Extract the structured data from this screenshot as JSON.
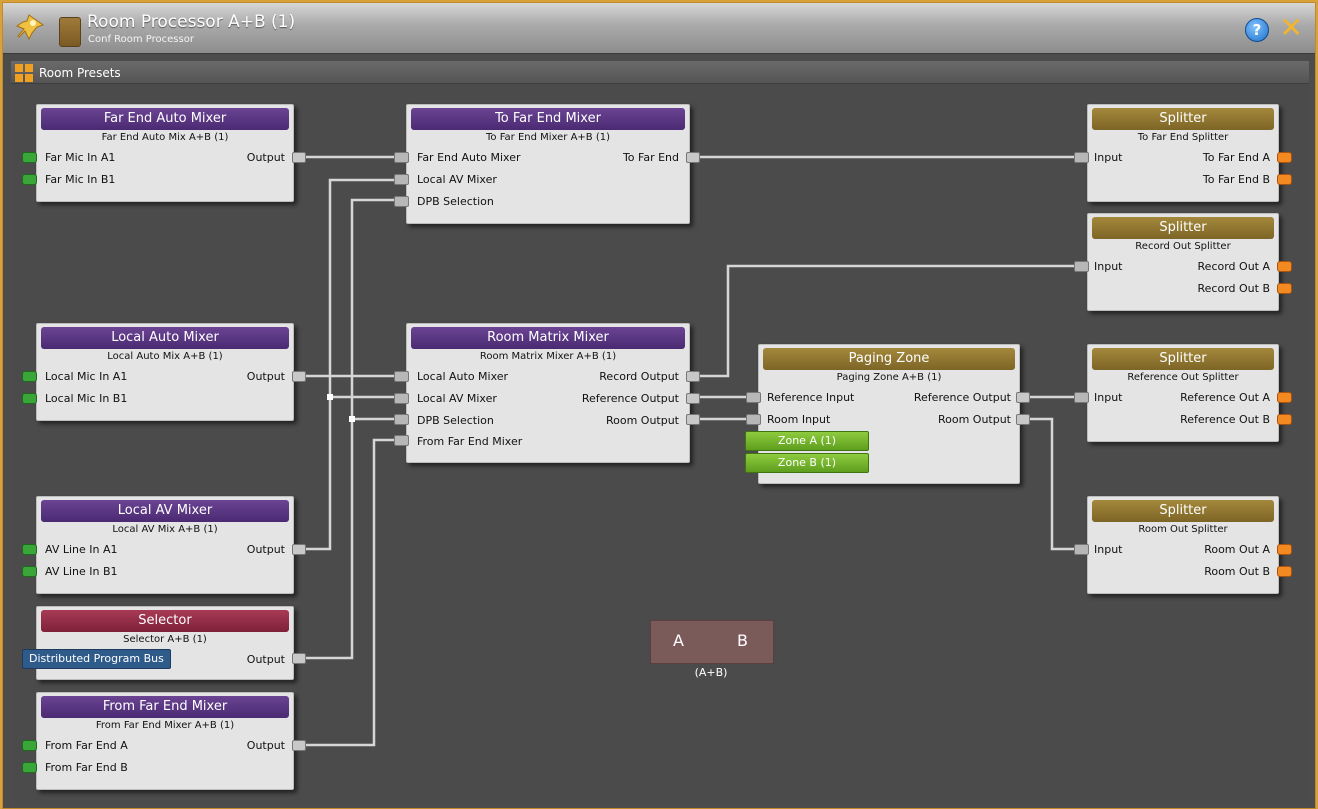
{
  "window": {
    "title": "Room Processor A+B (1)",
    "subtitle": "Conf Room Processor",
    "help_label": "?",
    "close_label": "✕"
  },
  "toolbar": {
    "presets_label": "Room Presets"
  },
  "blocks": {
    "far_end_auto_mixer": {
      "title": "Far End Auto Mixer",
      "sub": "Far End Auto Mix A+B (1)",
      "inputs": [
        "Far Mic In A1",
        "Far Mic In B1"
      ],
      "output": "Output"
    },
    "local_auto_mixer": {
      "title": "Local Auto Mixer",
      "sub": "Local Auto Mix A+B (1)",
      "inputs": [
        "Local Mic In A1",
        "Local Mic In B1"
      ],
      "output": "Output"
    },
    "local_av_mixer": {
      "title": "Local AV Mixer",
      "sub": "Local AV Mix A+B (1)",
      "inputs": [
        "AV Line In A1",
        "AV Line In B1"
      ],
      "output": "Output"
    },
    "selector": {
      "title": "Selector",
      "sub": "Selector A+B (1)",
      "input": "Distributed Program Bus",
      "output": "Output"
    },
    "from_far_end_mixer": {
      "title": "From Far End Mixer",
      "sub": "From Far End Mixer A+B (1)",
      "inputs": [
        "From Far End A",
        "From Far End B"
      ],
      "output": "Output"
    },
    "to_far_end_mixer": {
      "title": "To Far End Mixer",
      "sub": "To Far End Mixer A+B (1)",
      "inputs": [
        "Far End Auto Mixer",
        "Local AV Mixer",
        "DPB Selection"
      ],
      "output": "To Far End"
    },
    "room_matrix_mixer": {
      "title": "Room Matrix Mixer",
      "sub": "Room Matrix Mixer A+B (1)",
      "inputs": [
        "Local Auto Mixer",
        "Local AV Mixer",
        "DPB Selection",
        "From Far End Mixer"
      ],
      "outputs": [
        "Record Output",
        "Reference Output",
        "Room Output"
      ]
    },
    "paging_zone": {
      "title": "Paging Zone",
      "sub": "Paging Zone A+B (1)",
      "inputs": [
        "Reference Input",
        "Room Input"
      ],
      "outputs": [
        "Reference Output",
        "Room Output"
      ],
      "zones": [
        "Zone A (1)",
        "Zone B (1)"
      ]
    },
    "splitter_far_end": {
      "title": "Splitter",
      "sub": "To Far End Splitter",
      "input": "Input",
      "outputs": [
        "To Far End A",
        "To Far End B"
      ]
    },
    "splitter_record": {
      "title": "Splitter",
      "sub": "Record Out Splitter",
      "input": "Input",
      "outputs": [
        "Record Out A",
        "Record Out B"
      ]
    },
    "splitter_reference": {
      "title": "Splitter",
      "sub": "Reference Out Splitter",
      "input": "Input",
      "outputs": [
        "Reference Out A",
        "Reference Out B"
      ]
    },
    "splitter_room": {
      "title": "Splitter",
      "sub": "Room Out Splitter",
      "input": "Input",
      "outputs": [
        "Room Out A",
        "Room Out B"
      ]
    }
  },
  "room_combine": {
    "a": "A",
    "b": "B",
    "label": "(A+B)"
  },
  "colors": {
    "accent": "#d8a23b",
    "purple_header": "#5a3583",
    "gold_header": "#8e7430",
    "red_header": "#952c47",
    "input_connector": "#3aa63a",
    "output_connector": "#f28a21"
  }
}
